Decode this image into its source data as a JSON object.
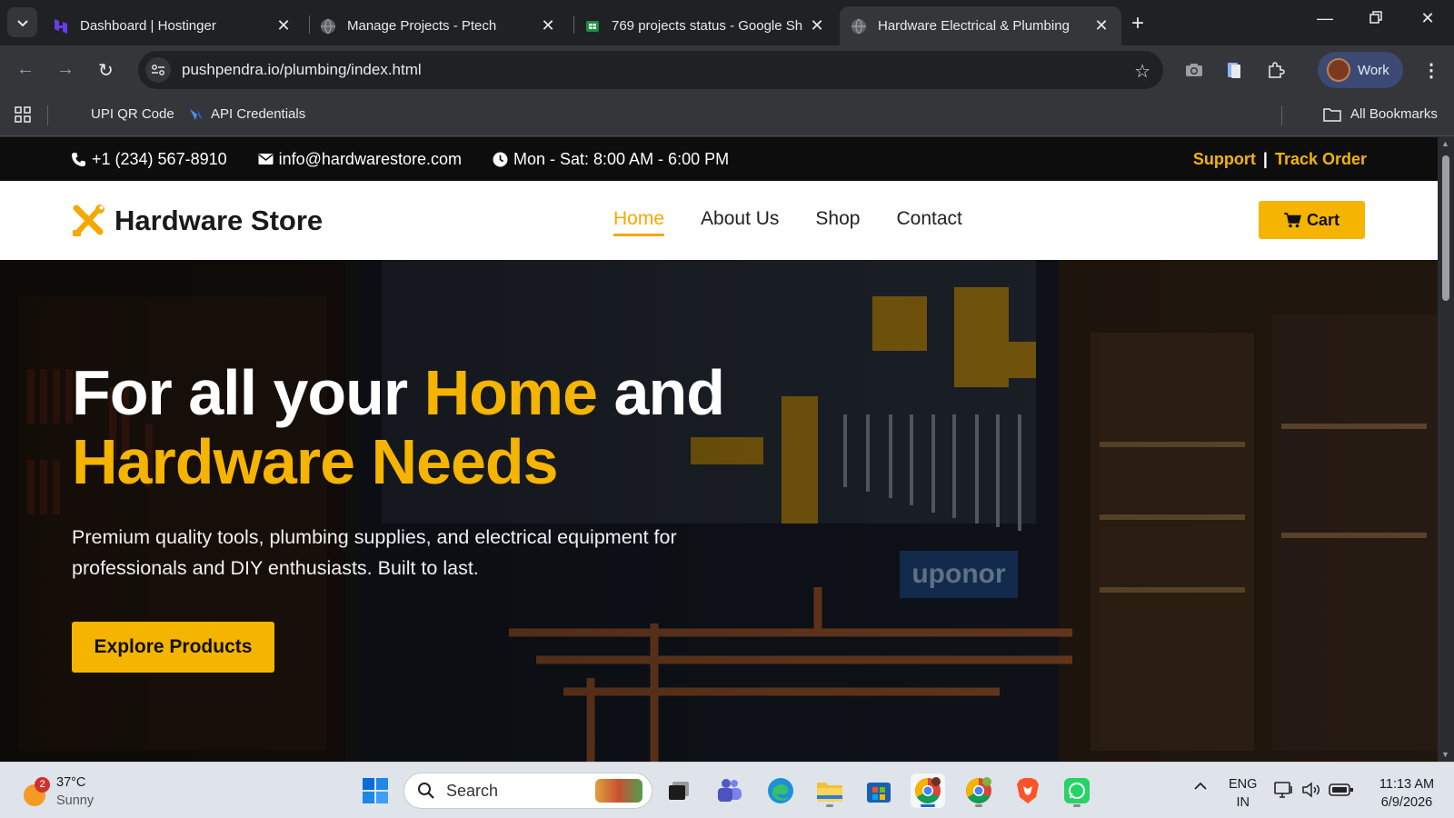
{
  "browser": {
    "tabs": [
      {
        "title": "Dashboard | Hostinger"
      },
      {
        "title": "Manage Projects - Ptech"
      },
      {
        "title": "769 projects status - Google Sh"
      },
      {
        "title": "Hardware Electrical & Plumbing"
      }
    ],
    "url": "pushpendra.io/plumbing/index.html",
    "profile_label": "Work",
    "bookmarks": [
      {
        "label": "UPI QR Code"
      },
      {
        "label": "API Credentials"
      }
    ],
    "all_bookmarks": "All Bookmarks"
  },
  "site": {
    "topbar": {
      "phone": "+1 (234) 567-8910",
      "email": "info@hardwarestore.com",
      "hours": "Mon - Sat: 8:00 AM - 6:00 PM",
      "support": "Support",
      "separator": "|",
      "track_order": "Track Order"
    },
    "header": {
      "logo_text": "Hardware Store",
      "nav": [
        "Home",
        "About Us",
        "Shop",
        "Contact"
      ],
      "cart_label": "Cart"
    },
    "hero": {
      "title_part1": "For all your ",
      "title_highlight1": "Home",
      "title_part2": " and",
      "title_highlight2": "Hardware Needs",
      "subtitle": "Premium quality tools, plumbing supplies, and electrical equipment for professionals and DIY enthusiasts. Built to last.",
      "cta": "Explore Products",
      "bg_sign": "uponor"
    },
    "accent_color": "#f5b400"
  },
  "taskbar": {
    "weather_temp": "37°C",
    "weather_desc": "Sunny",
    "weather_badge": "2",
    "search_placeholder": "Search",
    "lang_top": "ENG",
    "lang_bottom": "IN",
    "time": "11:13 AM",
    "date": "6/9/2026"
  }
}
